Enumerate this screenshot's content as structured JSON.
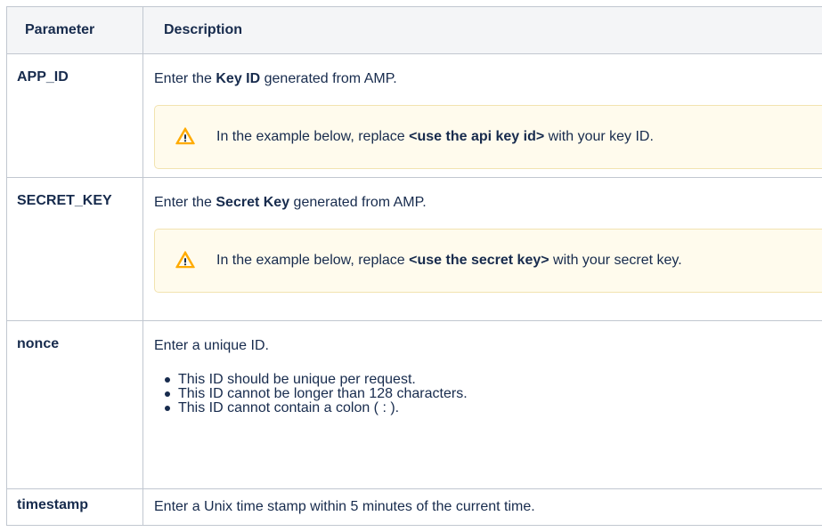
{
  "table": {
    "headers": {
      "parameter": "Parameter",
      "description": "Description"
    },
    "rows": [
      {
        "param": "APP_ID",
        "desc_pre": "Enter the ",
        "desc_bold": "Key ID",
        "desc_post": " generated from AMP.",
        "warning": {
          "icon": "warning-icon",
          "pre": "In the example below, replace ",
          "bold": "<use the api key id>",
          "post": " with your key ID."
        }
      },
      {
        "param": "SECRET_KEY",
        "desc_pre": "Enter the ",
        "desc_bold": "Secret Key",
        "desc_post": " generated from AMP.",
        "warning": {
          "icon": "warning-icon",
          "pre": "In the example below, replace ",
          "bold": "<use the secret key>",
          "post": " with your secret key."
        }
      },
      {
        "param": "nonce",
        "desc": "Enter a unique ID.",
        "bullets": [
          "This ID should be unique per request.",
          "This ID cannot be longer than 128 characters.",
          "This ID cannot contain a colon ( : )."
        ]
      },
      {
        "param": "timestamp",
        "desc": "Enter a Unix time stamp within 5 minutes of the current time."
      }
    ]
  },
  "colors": {
    "text": "#172b4d",
    "header_bg": "#f4f5f7",
    "border": "#c1c7d0",
    "warning_bg": "#fffbed",
    "warning_border": "#f2e3b0",
    "warning_icon": "#ffab00"
  }
}
